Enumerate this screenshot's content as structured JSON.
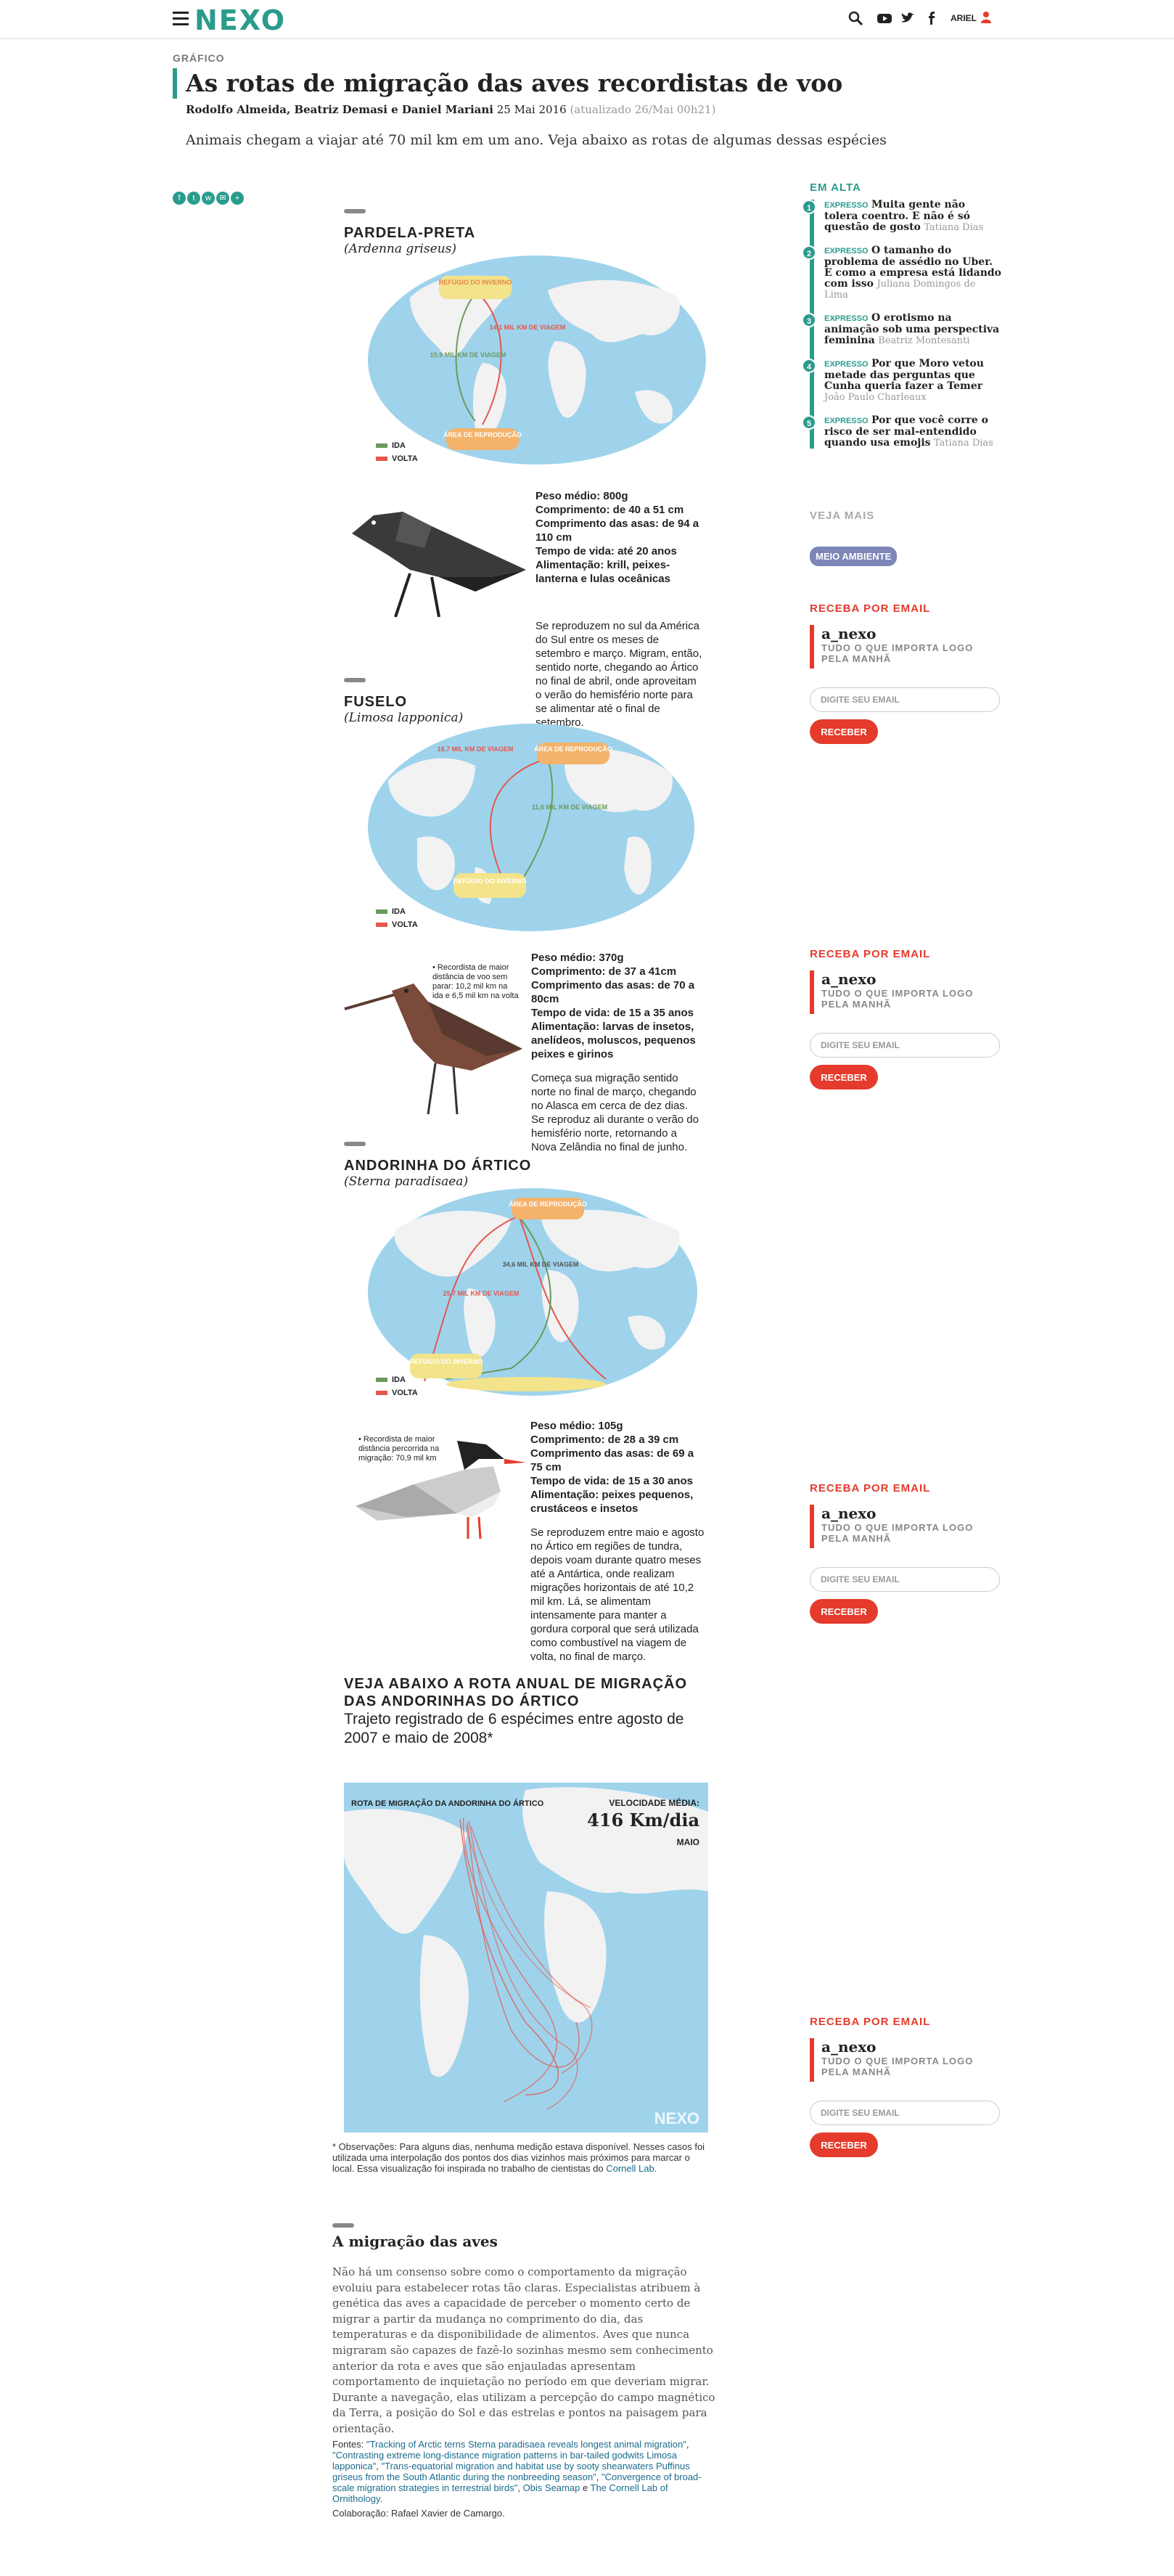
{
  "header": {
    "logo": "NEXO",
    "user": "ARIEL",
    "icons": [
      "menu-icon",
      "search-icon",
      "youtube-icon",
      "twitter-icon",
      "facebook-icon",
      "user-icon"
    ]
  },
  "article": {
    "kicker": "GRÁFICO",
    "title": "As rotas de migração das aves recordistas de voo",
    "authors": "Rodolfo Almeida, Beatriz Demasi e Daniel Mariani",
    "date": "25 Mai 2016",
    "updated": "(atualizado 26/Mai 00h21)",
    "subtitle": "Animais chegam a viajar até 70 mil km em um ano. Veja abaixo as rotas de algumas dessas espécies"
  },
  "legend": {
    "ida": "IDA",
    "volta": "VOLTA"
  },
  "colors": {
    "ida": "#6a9a5c",
    "volta": "#e4574d",
    "brand": "#2a9c8c",
    "accent": "#e43b2c",
    "ocean": "#9fd3ec",
    "label_box": "#f4b26a",
    "winter": "#f3e38a"
  },
  "birds": [
    {
      "name": "PARDELA-PRETA",
      "sci": "(Ardenna griseus)",
      "map_labels": {
        "winter": "REFÚGIO DO INVERNO",
        "breeding": "ÁREA DE REPRODUÇÃO",
        "ida_km": "15,9 MIL KM DE VIAGEM",
        "volta_km": "14,1 MIL KM DE VIAGEM"
      },
      "facts": [
        {
          "k": "Peso médio:",
          "v": "800g"
        },
        {
          "k": "Comprimento:",
          "v": "de 40 a 51 cm"
        },
        {
          "k": "Comprimento das asas:",
          "v": "de 94 a 110 cm"
        },
        {
          "k": "Tempo de vida:",
          "v": "até 20 anos"
        },
        {
          "k": "Alimentação:",
          "v": "krill, peixes-lanterna e lulas oceânicas"
        }
      ],
      "desc": "Se reproduzem no sul da América do Sul entre os meses de setembro e março. Migram, então, sentido norte, chegando ao Ártico no final de abril, onde aproveitam o verão do hemisfério norte para se alimentar até o final de setembro."
    },
    {
      "name": "FUSELO",
      "sci": "(Limosa lapponica)",
      "map_labels": {
        "winter": "REFÚGIO DO INVERNO",
        "breeding": "ÁREA DE REPRODUÇÃO",
        "ida_km": "11,6 MIL KM DE VIAGEM",
        "volta_km": "16,7 MIL KM DE VIAGEM"
      },
      "note": "Recordista de maior distância de voo sem parar: 10,2 mil km na ida e 6,5 mil km na volta",
      "facts": [
        {
          "k": "Peso médio:",
          "v": "370g"
        },
        {
          "k": "Comprimento:",
          "v": "de 37 a 41cm"
        },
        {
          "k": "Comprimento das asas:",
          "v": "de 70 a 80cm"
        },
        {
          "k": "Tempo de vida:",
          "v": "de 15 a 35 anos"
        },
        {
          "k": "Alimentação:",
          "v": "larvas de insetos, anelídeos, moluscos, pequenos peixes e girinos"
        }
      ],
      "desc": "Começa sua migração sentido norte no final de março, chegando no Alasca em cerca de dez dias. Se reproduz ali durante o verão do hemisfério norte, retornando a Nova Zelândia no final de junho."
    },
    {
      "name": "ANDORINHA DO ÁRTICO",
      "sci": "(Sterna paradisaea)",
      "map_labels": {
        "winter": "REFÚGIO DO INVERNO",
        "breeding": "ÁREA DE REPRODUÇÃO",
        "ida_km": "34,6 MIL KM DE VIAGEM",
        "volta_km": "25,7 MIL KM DE VIAGEM"
      },
      "note": "Recordista de maior distância percorrida na migração: 70,9 mil km",
      "facts": [
        {
          "k": "Peso médio:",
          "v": "105g"
        },
        {
          "k": "Comprimento:",
          "v": "de 28 a 39 cm"
        },
        {
          "k": "Comprimento das asas:",
          "v": "de 69 a 75 cm"
        },
        {
          "k": "Tempo de vida:",
          "v": "de 15 a 30 anos"
        },
        {
          "k": "Alimentação:",
          "v": "peixes pequenos, crustáceos e insetos"
        }
      ],
      "desc": "Se reproduzem entre maio e agosto no Ártico em regiões de tundra, depois voam durante quatro meses até a Antártica, onde realizam migrações horizontais de até 10,2 mil km. Lá, se alimentam intensamente para manter a gordura corporal que será utilizada como combustível na viagem de volta, no final de março."
    }
  ],
  "annual": {
    "title": "VEJA ABAIXO A ROTA ANUAL DE MIGRAÇÃO DAS ANDORINHAS DO ÁRTICO",
    "subtitle": "Trajeto registrado de 6 espécimes entre agosto de 2007 e maio de 2008*",
    "map_label": "ROTA DE MIGRAÇÃO DA ANDORINHA DO ÁRTICO",
    "speed_label": "VELOCIDADE MÉDIA:",
    "speed": "416 Km/dia",
    "month": "MAIO",
    "watermark": "NEXO"
  },
  "obs": {
    "text": "* Observações: Para alguns dias, nenhuma medição estava disponível. Nesses casos foi utilizada uma interpolação dos pontos dos dias vizinhos mais próximos para marcar o local. Essa visualização foi inspirada no trabalho de cientistas do ",
    "link": "Cornell Lab."
  },
  "migration": {
    "title": "A migração das aves",
    "text": "Não há um consenso sobre como o comportamento da migração evoluiu para estabelecer rotas tão claras. Especialistas atribuem à genética das aves a capacidade de perceber o momento certo de migrar a partir da mudança no comprimento do dia, das temperaturas e da disponibilidade de alimentos. Aves que nunca migraram são capazes de fazê-lo sozinhas mesmo sem conhecimento anterior da rota e aves que são enjauladas apresentam comportamento de inquietação no período em que deveriam migrar. Durante a navegação, elas utilizam a percepção do campo magnético da Terra, a posição do Sol e das estrelas e pontos na paisagem para orientação."
  },
  "sources": {
    "label": "Fontes:",
    "links": [
      "\"Tracking of Arctic terns Sterna paradisaea reveals longest animal migration\"",
      "\"Contrasting extreme long-distance migration patterns in bar-tailed godwits Limosa lapponica\"",
      "\"Trans-equatorial migration and habitat use by sooty shearwaters Puffinus griseus from the South Atlantic during the nonbreeding season\"",
      "\"Convergence of broad-scale migration strategies in terrestrial birds\"",
      "Obis Seamap",
      "The Cornell Lab of Ornithology"
    ],
    "last_sep": " e ",
    "collab_label": "Colaboração:",
    "collab": "Rafael Xavier de Camargo."
  },
  "sidebar": {
    "em_alta": "EM ALTA",
    "items": [
      {
        "num": "1",
        "tag": "EXPRESSO",
        "title": "Muita gente não tolera coentro. E não é só questão de gosto",
        "author": "Tatiana Dias"
      },
      {
        "num": "2",
        "tag": "EXPRESSO",
        "title": "O tamanho do problema de assédio no Uber. E como a empresa está lidando com isso",
        "author": "Juliana Domingos de Lima"
      },
      {
        "num": "3",
        "tag": "EXPRESSO",
        "title": "O erotismo na animação sob uma perspectiva feminina",
        "author": "Beatriz Montesanti"
      },
      {
        "num": "4",
        "tag": "EXPRESSO",
        "title": "Por que Moro vetou metade das perguntas que Cunha queria fazer a Temer",
        "author": "João Paulo Charleaux"
      },
      {
        "num": "5",
        "tag": "EXPRESSO",
        "title": "Por que você corre o risco de ser mal-entendido quando usa emojis",
        "author": "Tatiana Dias"
      }
    ],
    "veja_mais": "VEJA MAIS",
    "tag": "MEIO AMBIENTE",
    "newsletter": {
      "heading": "RECEBA POR EMAIL",
      "logo": "a_nexo",
      "tagline": "TUDO O QUE IMPORTA LOGO PELA MANHÃ",
      "placeholder": "DIGITE SEU EMAIL",
      "button": "RECEBER"
    }
  }
}
